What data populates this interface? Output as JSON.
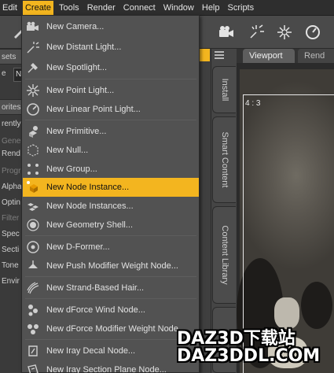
{
  "menubar": {
    "items": [
      "Edit",
      "Create",
      "Tools",
      "Render",
      "Connect",
      "Window",
      "Help",
      "Scripts"
    ],
    "active": "Create"
  },
  "toolbar": {
    "icons": [
      "camera-icon",
      "light-burst-icon",
      "spotlight-icon",
      "gauge-icon"
    ]
  },
  "left_panel": {
    "rows": [
      "sets",
      "e",
      "orites",
      "rently",
      "Gene",
      "Rend",
      "Progr",
      "Alpha",
      "Optin",
      "Filter",
      "Spec",
      "Secti",
      "Tone",
      "Envir"
    ],
    "field_value": "N"
  },
  "create_menu": {
    "items": [
      {
        "label": "New Camera...",
        "icon": "camera-icon"
      },
      {
        "label": "New Distant Light...",
        "icon": "distant-light-icon"
      },
      {
        "label": "New Spotlight...",
        "icon": "spotlight-icon"
      },
      {
        "label": "New Point Light...",
        "icon": "point-light-icon"
      },
      {
        "label": "New Linear Point Light...",
        "icon": "linear-point-light-icon"
      },
      {
        "label": "New Primitive...",
        "icon": "primitive-icon"
      },
      {
        "label": "New Null...",
        "icon": "null-icon"
      },
      {
        "label": "New Group...",
        "icon": "group-icon"
      },
      {
        "label": "New Node Instance...",
        "icon": "node-instance-icon"
      },
      {
        "label": "New Node Instances...",
        "icon": "node-instances-icon"
      },
      {
        "label": "New Geometry Shell...",
        "icon": "geometry-shell-icon"
      },
      {
        "label": "New D-Former...",
        "icon": "dformer-icon"
      },
      {
        "label": "New Push Modifier Weight Node...",
        "icon": "push-modifier-icon"
      },
      {
        "label": "New Strand-Based Hair...",
        "icon": "strand-hair-icon"
      },
      {
        "label": "New dForce Wind Node...",
        "icon": "dforce-wind-icon"
      },
      {
        "label": "New dForce Modifier Weight Node...",
        "icon": "dforce-modifier-icon"
      },
      {
        "label": "New Iray Decal Node...",
        "icon": "iray-decal-icon"
      },
      {
        "label": "New Iray Section Plane Node...",
        "icon": "iray-section-plane-icon"
      }
    ],
    "highlighted": "New Node Instance..."
  },
  "side_tabs": [
    "Install",
    "Smart Content",
    "Content Library",
    "To"
  ],
  "viewport": {
    "tabs": [
      "Viewport",
      "Rend"
    ],
    "aspect_label": "4 : 3"
  },
  "watermark": {
    "line1": "DAZ3D下载站",
    "line2": "DAZ3DDL.COM"
  },
  "colors": {
    "accent": "#f3b51f",
    "menu_bg": "#525252",
    "menubar_bg": "#2e2e2e"
  }
}
